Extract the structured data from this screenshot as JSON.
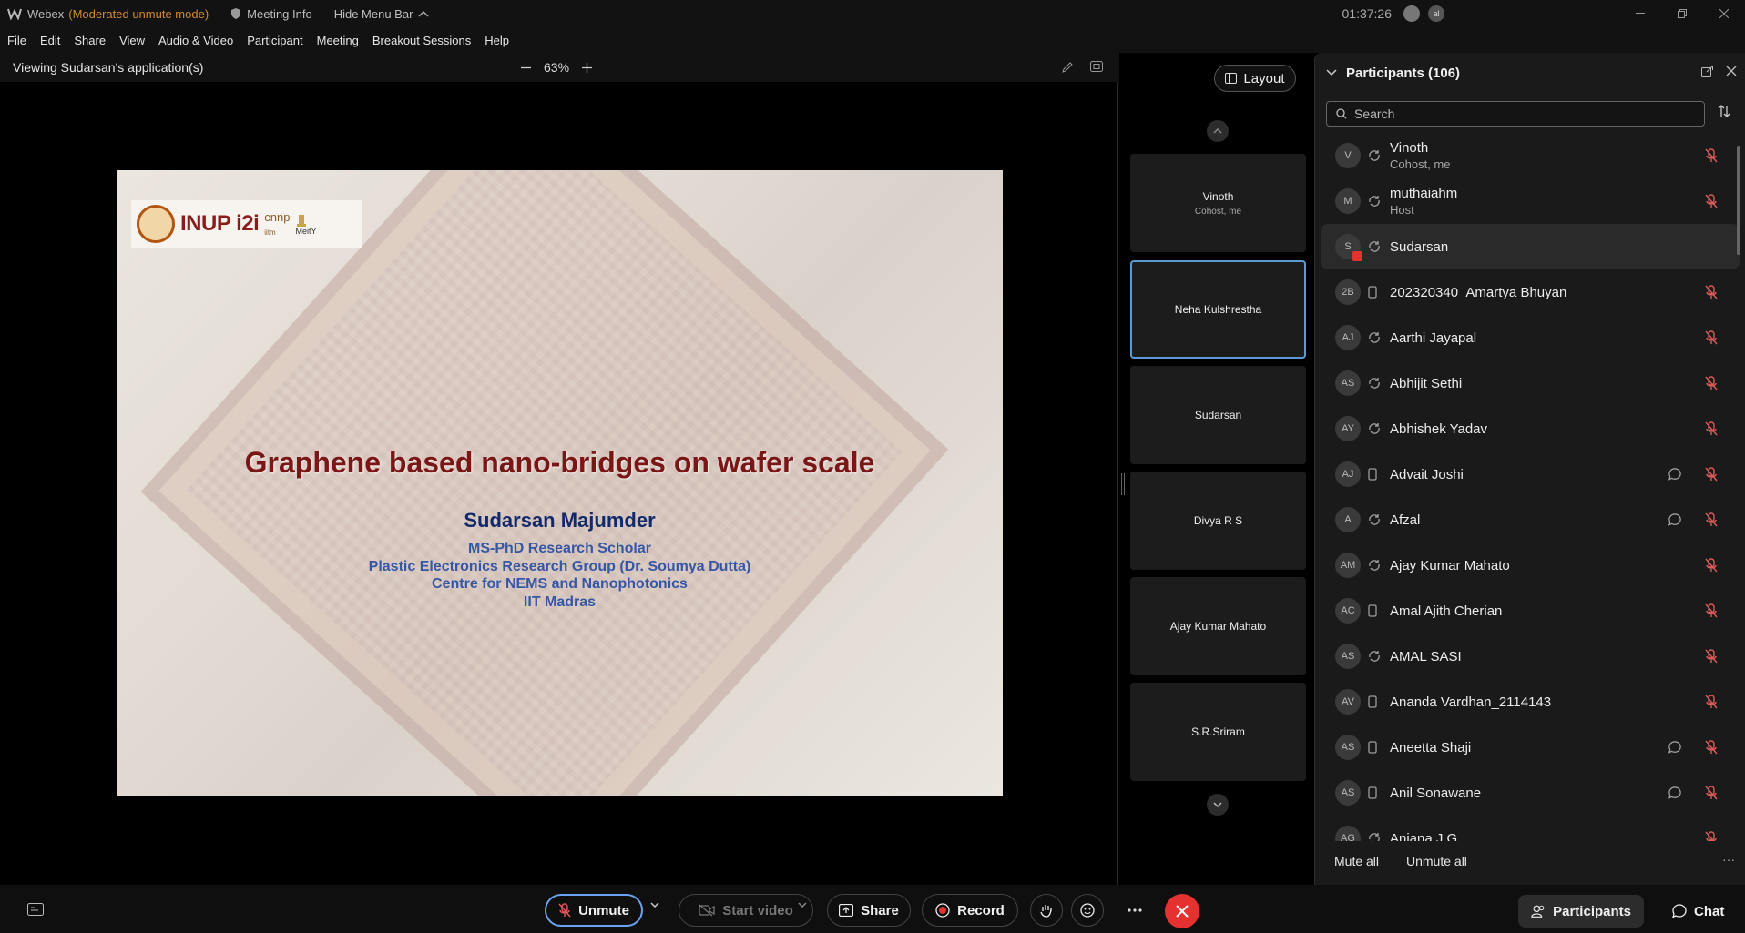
{
  "titlebar": {
    "app": "Webex",
    "mode": "(Moderated unmute mode)",
    "meeting_info": "Meeting Info",
    "hide_menu": "Hide Menu Bar",
    "clock": "01:37:26",
    "avatar_initials": "al"
  },
  "menu": [
    "File",
    "Edit",
    "Share",
    "View",
    "Audio & Video",
    "Participant",
    "Meeting",
    "Breakout Sessions",
    "Help"
  ],
  "viewbar": {
    "label": "Viewing Sudarsan's application(s)",
    "zoom": "63%"
  },
  "slide": {
    "logo_text": "INUP i2i",
    "logo_cnnp": "cnnp",
    "logo_iitm": "iitm",
    "logo_meity": "MeitY",
    "title": "Graphene based nano-bridges on wafer scale",
    "author": "Sudarsan Majumder",
    "lines": [
      "MS-PhD Research Scholar",
      "Plastic Electronics Research Group (Dr. Soumya Dutta)",
      "Centre for NEMS and Nanophotonics",
      "IIT Madras"
    ]
  },
  "video": {
    "layout_label": "Layout",
    "tiles": [
      {
        "name": "Vinoth",
        "sub": "Cohost, me"
      },
      {
        "name": "Neha Kulshrestha",
        "sub": ""
      },
      {
        "name": "Sudarsan",
        "sub": ""
      },
      {
        "name": "Divya R S",
        "sub": ""
      },
      {
        "name": "Ajay Kumar Mahato",
        "sub": ""
      },
      {
        "name": "S.R.Sriram",
        "sub": ""
      }
    ]
  },
  "participants": {
    "title": "Participants (106)",
    "search_placeholder": "Search",
    "rows": [
      {
        "initials": "V",
        "name": "Vinoth",
        "role": "Cohost, me",
        "device": "web",
        "chat": false,
        "highlight": false
      },
      {
        "initials": "M",
        "name": "muthaiahm",
        "role": "Host",
        "device": "web",
        "chat": false,
        "highlight": false
      },
      {
        "initials": "S",
        "name": "Sudarsan",
        "role": "",
        "device": "web",
        "chat": false,
        "highlight": true,
        "sharing": true
      },
      {
        "initials": "2B",
        "name": "202320340_Amartya Bhuyan",
        "role": "",
        "device": "phone",
        "chat": false,
        "highlight": false
      },
      {
        "initials": "AJ",
        "name": "Aarthi Jayapal",
        "role": "",
        "device": "web",
        "chat": false,
        "highlight": false
      },
      {
        "initials": "AS",
        "name": "Abhijit Sethi",
        "role": "",
        "device": "web",
        "chat": false,
        "highlight": false
      },
      {
        "initials": "AY",
        "name": "Abhishek Yadav",
        "role": "",
        "device": "web",
        "chat": false,
        "highlight": false
      },
      {
        "initials": "AJ",
        "name": "Advait Joshi",
        "role": "",
        "device": "phone",
        "chat": true,
        "highlight": false
      },
      {
        "initials": "A",
        "name": "Afzal",
        "role": "",
        "device": "web",
        "chat": true,
        "highlight": false
      },
      {
        "initials": "AM",
        "name": "Ajay Kumar Mahato",
        "role": "",
        "device": "web",
        "chat": false,
        "highlight": false
      },
      {
        "initials": "AC",
        "name": "Amal Ajith Cherian",
        "role": "",
        "device": "phone",
        "chat": false,
        "highlight": false
      },
      {
        "initials": "AS",
        "name": "AMAL SASI",
        "role": "",
        "device": "web",
        "chat": false,
        "highlight": false
      },
      {
        "initials": "AV",
        "name": "Ananda Vardhan_2114143",
        "role": "",
        "device": "phone",
        "chat": false,
        "highlight": false
      },
      {
        "initials": "AS",
        "name": "Aneetta Shaji",
        "role": "",
        "device": "phone",
        "chat": true,
        "highlight": false
      },
      {
        "initials": "AS",
        "name": "Anil Sonawane",
        "role": "",
        "device": "phone",
        "chat": true,
        "highlight": false
      },
      {
        "initials": "AG",
        "name": "Aniana J G",
        "role": "",
        "device": "web",
        "chat": false,
        "highlight": false
      }
    ],
    "mute_all": "Mute all",
    "unmute_all": "Unmute all"
  },
  "controls": {
    "unmute": "Unmute",
    "start_video": "Start video",
    "share": "Share",
    "record": "Record",
    "participants_tab": "Participants",
    "chat_tab": "Chat"
  },
  "colors": {
    "accent": "#5b9bd5",
    "end_call": "#e5312f",
    "muted_mic": "#e05a5a",
    "mode_text": "#d28b2a"
  }
}
